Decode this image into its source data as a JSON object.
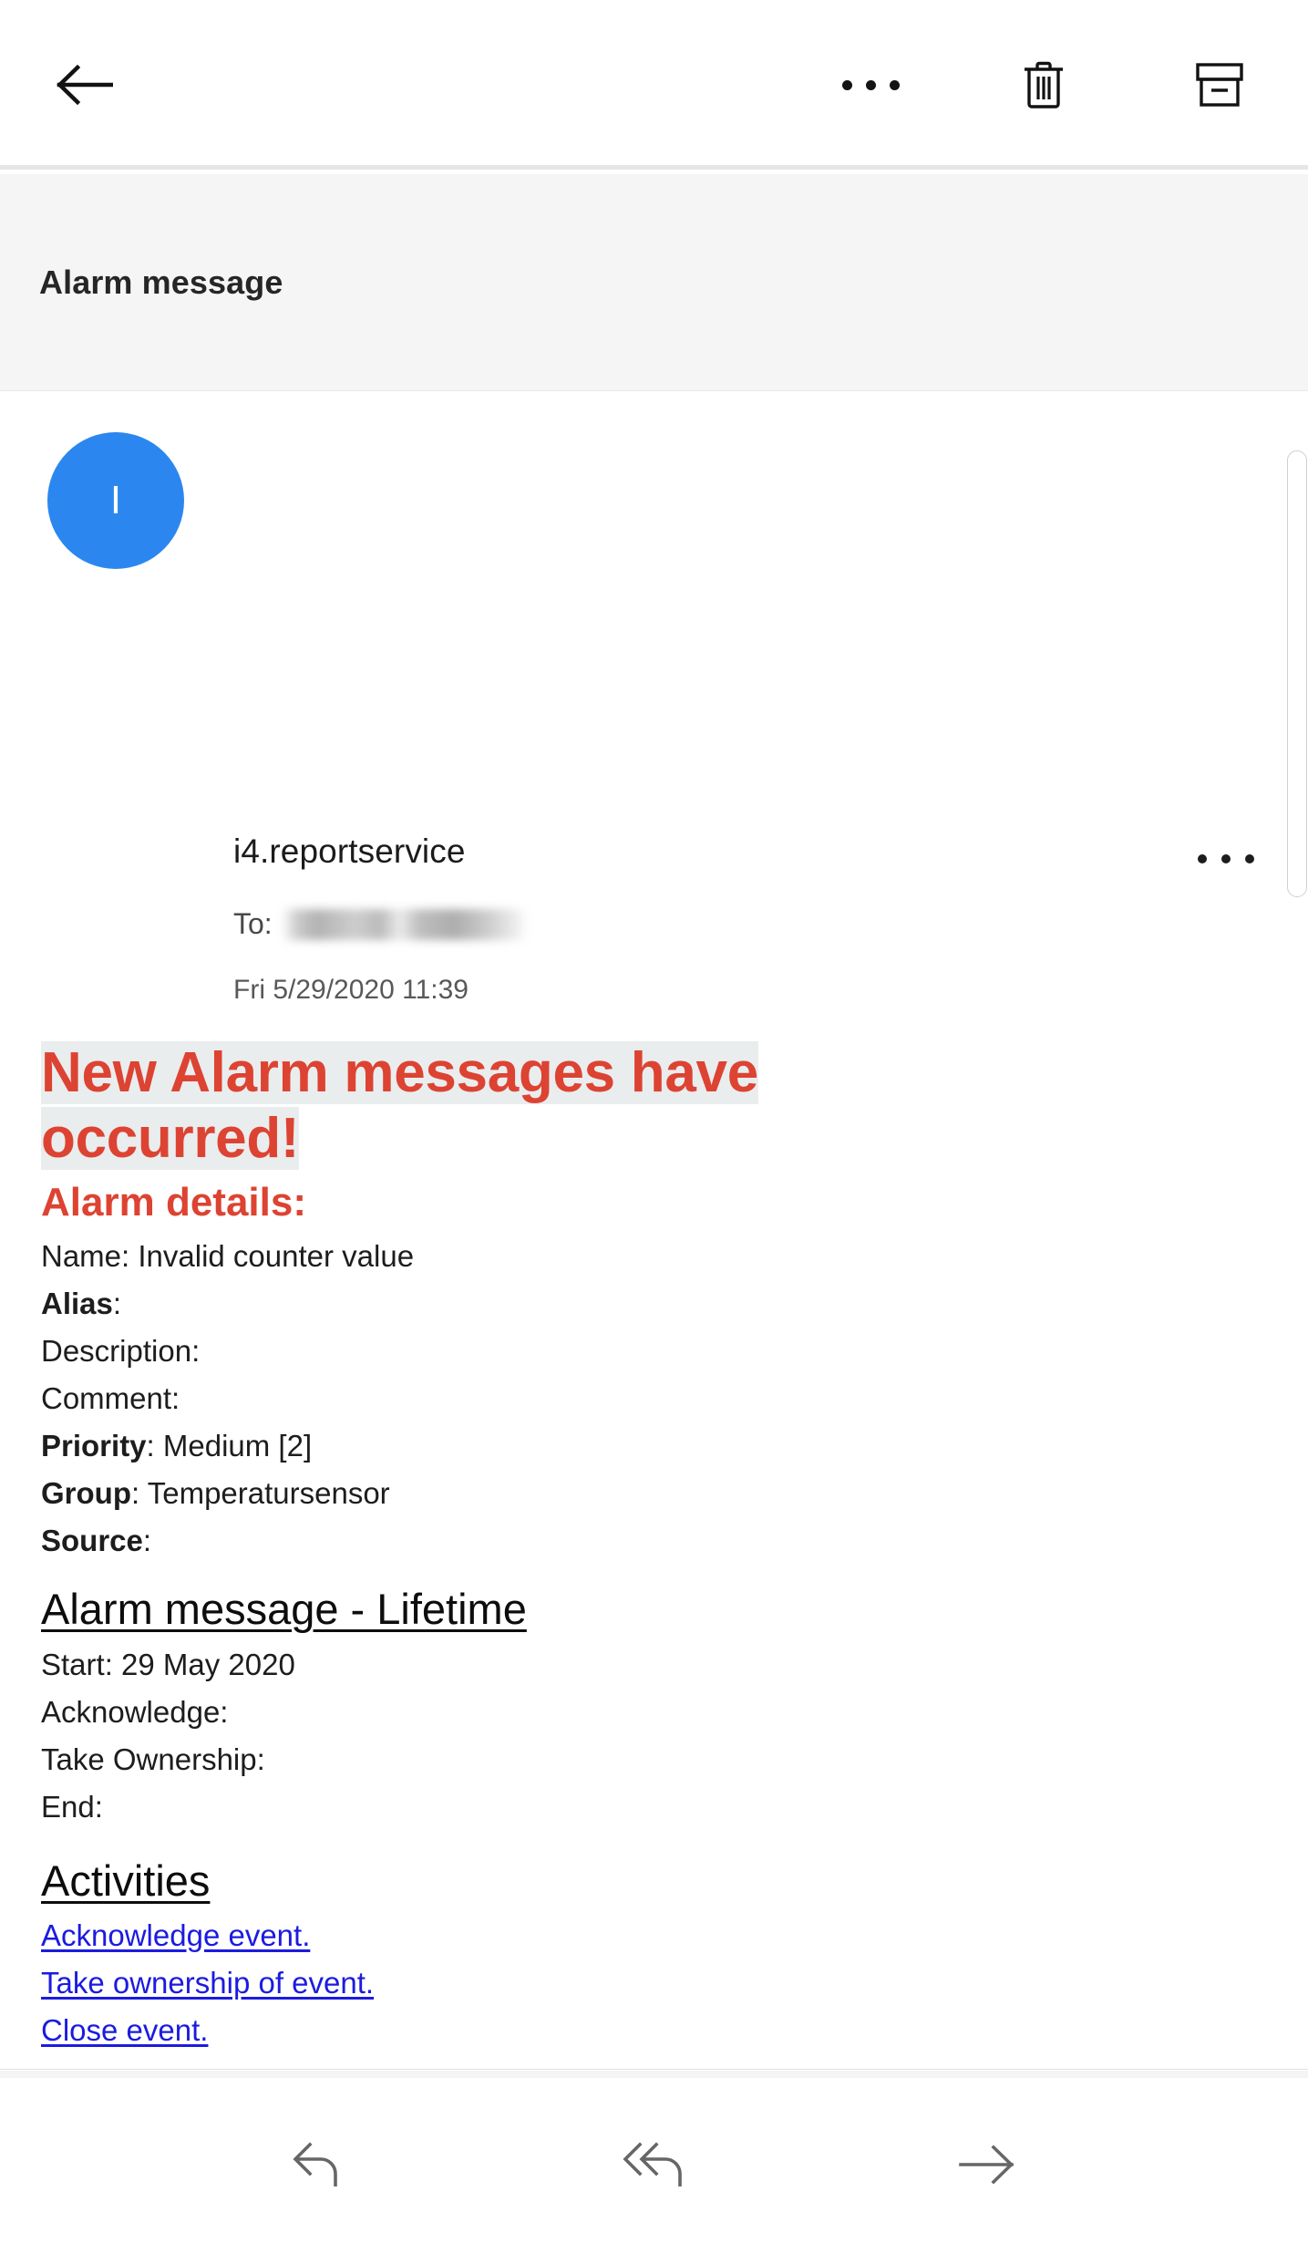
{
  "top_toolbar": {
    "back_label": "back-arrow",
    "more_label": "more-options",
    "delete_label": "delete",
    "archive_label": "archive"
  },
  "subject": {
    "title": "Alarm message"
  },
  "message": {
    "avatar_initial": "I",
    "sender": "i4.reportservice",
    "to_label": "To:",
    "to_value_redacted": "",
    "date": "Fri 5/29/2020 11:39",
    "more_label": "message-options"
  },
  "body": {
    "headline_line1": "New Alarm messages have",
    "headline_line2": "occurred!",
    "alarm_details_heading": "Alarm details:",
    "details": [
      {
        "label": "Name",
        "bold": false,
        "value": " Invalid counter value"
      },
      {
        "label": "Alias",
        "bold": true,
        "value": ""
      },
      {
        "label": "Description",
        "bold": false,
        "value": ""
      },
      {
        "label": "Comment",
        "bold": false,
        "value": ""
      },
      {
        "label": "Priority",
        "bold": true,
        "value": " Medium [2]"
      },
      {
        "label": "Group",
        "bold": true,
        "value": " Temperatursensor"
      },
      {
        "label": "Source",
        "bold": true,
        "value": ""
      }
    ],
    "lifetime_heading": "Alarm message - Lifetime",
    "lifetime": [
      {
        "label": "Start",
        "value": " 29 May 2020"
      },
      {
        "label": "Acknowledge",
        "value": ""
      },
      {
        "label": "Take Ownership",
        "value": ""
      },
      {
        "label": "End",
        "value": ""
      }
    ],
    "activities_heading": "Activities",
    "activities": [
      "Acknowledge event.",
      "Take ownership of event.",
      "Close event."
    ],
    "separator": "-------------------------------------------------------"
  },
  "bottom_toolbar": {
    "reply_label": "reply",
    "reply_all_label": "reply-all",
    "forward_label": "forward"
  },
  "colors": {
    "accent_red": "#dd4332",
    "avatar_blue": "#2b87ef",
    "link_blue": "#1b1be0",
    "highlight_gray": "#eaedee",
    "band_gray": "#f5f5f5"
  }
}
